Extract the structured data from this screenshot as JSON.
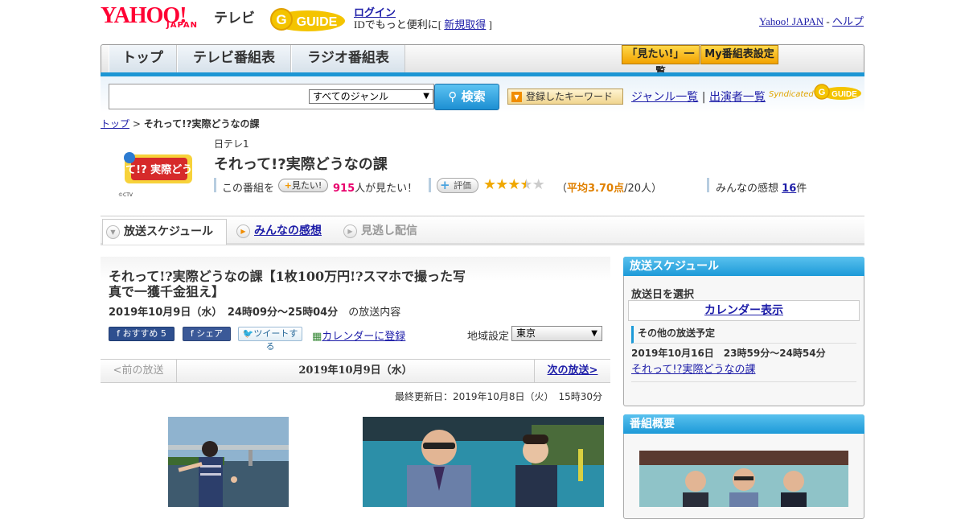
{
  "header": {
    "logo_main": "YAHOO!",
    "logo_sub": "JAPAN",
    "service_name": "テレビ",
    "gguide_label": "GUIDE",
    "login_link": "ログイン",
    "id_prefix": "IDでもっと便利に[",
    "signup_link": "新規取得",
    "id_suffix": "]",
    "yahoo_japan_link": "Yahoo! JAPAN",
    "separator": " - ",
    "help_link": "ヘルプ"
  },
  "nav": {
    "tabs": [
      "トップ",
      "テレビ番組表",
      "ラジオ番組表"
    ],
    "wishlist_button": "「見たい!」一覧",
    "my_schedule_button": "My番組表設定"
  },
  "search": {
    "input_value": "",
    "genre_selected": "すべてのジャンル",
    "search_button": "検索",
    "keyword_button": "登録したキーワード",
    "genre_list_link": "ジャンル一覧",
    "divider": "|",
    "performer_list_link": "出演者一覧",
    "syndicated_label": "Syndicated",
    "gguide_label": "GUIDE"
  },
  "breadcrumb": {
    "top_link": "トップ",
    "separator": " > ",
    "current": "それって!?実際どうなの課"
  },
  "program": {
    "thumb_label": "それって!? 実際どうなの課",
    "thumb_credit": "©CTV",
    "station": "日テレ1",
    "title": "それって!?実際どうなの課",
    "want_prefix": "この番組を",
    "want_button_plus": "+",
    "want_button_label": "見たい!",
    "want_count": "915",
    "want_suffix": "人が見たい！",
    "eval_button": "評価",
    "rating": 3.7,
    "stars_on": "★★★",
    "stars_half": "★",
    "stars_off": "★",
    "avg_prefix": "（",
    "avg_value": "平均3.70点",
    "avg_suffix": "/20人）",
    "kanso_prefix": "みんなの感想",
    "kanso_count": "16",
    "kanso_suffix": "件"
  },
  "tabs": {
    "schedule": "放送スケジュール",
    "reviews": "みんなの感想",
    "missed": "見逃し配信"
  },
  "broadcast": {
    "title": "それって!?実際どうなの課【1枚100万円!?スマホで撮った写真で一獲千金狙え】",
    "date_bold": "2019年10月9日（水）　24時09分～25時04分",
    "date_suffix": "の放送内容",
    "recommend_button": "おすすめ 5",
    "share_button": "シェア",
    "tweet_button": "ツイートする",
    "calendar_link": "カレンダーに登録",
    "region_label": "地域設定",
    "region_selected": "東京"
  },
  "datenav": {
    "prev": "<前の放送",
    "current": "2019年10月9日（水）",
    "next": "次の放送>"
  },
  "updated": "最終更新日：2019年10月8日（火）　15時30分",
  "sidebar": {
    "schedule_header": "放送スケジュール",
    "select_day": "放送日を選択",
    "calendar_button": "カレンダー表示",
    "other_header": "その他の放送予定",
    "other_date": "2019年10月16日　23時59分～24時54分",
    "other_link": "それって!?実際どうなの課",
    "summary_header": "番組概要"
  },
  "colors": {
    "accent_blue": "#1d9ad8",
    "link": "#1d1da8",
    "star": "#f0a800",
    "want_count": "#e8006c"
  }
}
